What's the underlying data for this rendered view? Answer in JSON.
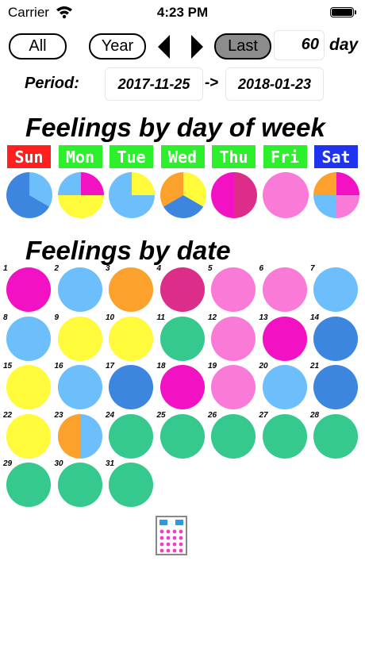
{
  "status": {
    "carrier": "Carrier",
    "time": "4:23 PM"
  },
  "toolbar": {
    "all_label": "All",
    "year_label": "Year",
    "last_label": "Last",
    "days_value": "60",
    "day_unit": "day"
  },
  "period": {
    "label": "Period:",
    "start": "2017-11-25",
    "arrow": "->",
    "end": "2018-01-23"
  },
  "titles": {
    "dow": "Feelings by day of week",
    "date": "Feelings by date"
  },
  "colors": {
    "blue": "#3d86e0",
    "lightblue": "#6cbffb",
    "yellow": "#fffa3a",
    "orange": "#fba12c",
    "magenta": "#f212c3",
    "crimson": "#dc2e88",
    "pink": "#fa7ad8",
    "green": "#35c98d",
    "red_label": "#ff1f1f",
    "green_label": "#2cf02c",
    "blue_label": "#1f32f0"
  },
  "days_of_week": [
    {
      "label": "Sun",
      "bg": "red_label",
      "slices": [
        {
          "c": "lightblue",
          "v": 1
        },
        {
          "c": "blue",
          "v": 2
        }
      ]
    },
    {
      "label": "Mon",
      "bg": "green_label",
      "slices": [
        {
          "c": "magenta",
          "v": 1
        },
        {
          "c": "yellow",
          "v": 2
        },
        {
          "c": "lightblue",
          "v": 1
        }
      ]
    },
    {
      "label": "Tue",
      "bg": "green_label",
      "slices": [
        {
          "c": "yellow",
          "v": 1
        },
        {
          "c": "lightblue",
          "v": 3
        }
      ]
    },
    {
      "label": "Wed",
      "bg": "green_label",
      "slices": [
        {
          "c": "yellow",
          "v": 1
        },
        {
          "c": "blue",
          "v": 1
        },
        {
          "c": "orange",
          "v": 1
        }
      ]
    },
    {
      "label": "Thu",
      "bg": "green_label",
      "slices": [
        {
          "c": "crimson",
          "v": 1
        },
        {
          "c": "magenta",
          "v": 1
        }
      ]
    },
    {
      "label": "Fri",
      "bg": "green_label",
      "slices": [
        {
          "c": "pink",
          "v": 1
        }
      ]
    },
    {
      "label": "Sat",
      "bg": "blue_label",
      "slices": [
        {
          "c": "magenta",
          "v": 1
        },
        {
          "c": "pink",
          "v": 1
        },
        {
          "c": "lightblue",
          "v": 1
        },
        {
          "c": "orange",
          "v": 1
        }
      ]
    }
  ],
  "dates": [
    {
      "day": "1",
      "colors": [
        "magenta"
      ]
    },
    {
      "day": "2",
      "colors": [
        "lightblue"
      ]
    },
    {
      "day": "3",
      "colors": [
        "orange"
      ]
    },
    {
      "day": "4",
      "colors": [
        "crimson"
      ]
    },
    {
      "day": "5",
      "colors": [
        "pink"
      ]
    },
    {
      "day": "6",
      "colors": [
        "pink"
      ]
    },
    {
      "day": "7",
      "colors": [
        "lightblue"
      ]
    },
    {
      "day": "8",
      "colors": [
        "lightblue"
      ]
    },
    {
      "day": "9",
      "colors": [
        "yellow"
      ]
    },
    {
      "day": "10",
      "colors": [
        "yellow"
      ]
    },
    {
      "day": "11",
      "colors": [
        "green"
      ]
    },
    {
      "day": "12",
      "colors": [
        "pink"
      ]
    },
    {
      "day": "13",
      "colors": [
        "magenta"
      ]
    },
    {
      "day": "14",
      "colors": [
        "blue"
      ]
    },
    {
      "day": "15",
      "colors": [
        "yellow"
      ]
    },
    {
      "day": "16",
      "colors": [
        "lightblue"
      ]
    },
    {
      "day": "17",
      "colors": [
        "blue"
      ]
    },
    {
      "day": "18",
      "colors": [
        "magenta"
      ]
    },
    {
      "day": "19",
      "colors": [
        "pink"
      ]
    },
    {
      "day": "20",
      "colors": [
        "lightblue"
      ]
    },
    {
      "day": "21",
      "colors": [
        "blue"
      ]
    },
    {
      "day": "22",
      "colors": [
        "yellow"
      ]
    },
    {
      "day": "23",
      "colors": [
        "orange",
        "lightblue"
      ]
    },
    {
      "day": "24",
      "colors": [
        "green"
      ]
    },
    {
      "day": "25",
      "colors": [
        "green"
      ]
    },
    {
      "day": "26",
      "colors": [
        "green"
      ]
    },
    {
      "day": "27",
      "colors": [
        "green"
      ]
    },
    {
      "day": "28",
      "colors": [
        "green"
      ]
    },
    {
      "day": "29",
      "colors": [
        "green"
      ]
    },
    {
      "day": "30",
      "colors": [
        "green"
      ]
    },
    {
      "day": "31",
      "colors": [
        "green"
      ]
    }
  ],
  "icons": {
    "calendar": "calendar-icon",
    "wifi": "wifi-icon",
    "battery": "battery-icon"
  }
}
